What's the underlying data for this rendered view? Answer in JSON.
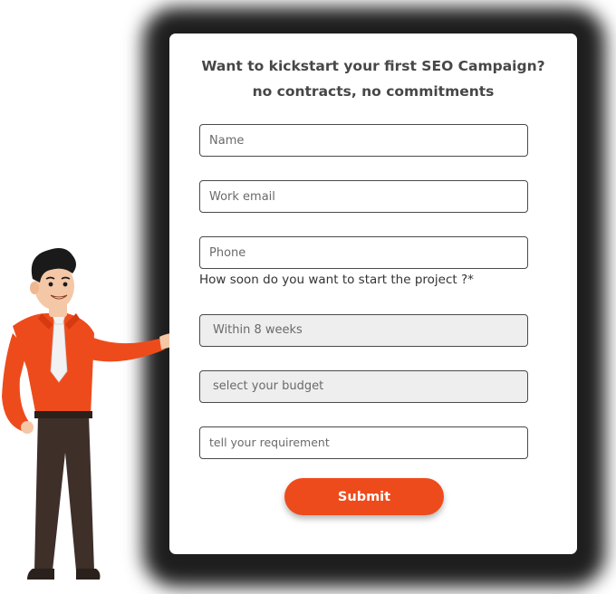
{
  "form": {
    "headline_line1": "Want to kickstart your first SEO Campaign?",
    "headline_line2": "no contracts, no commitments",
    "name_placeholder": "Name",
    "email_placeholder": "Work email",
    "phone_placeholder": "Phone",
    "timeline_question": "How soon do you want to start the project ?*",
    "timeline_selected": "Within 8 weeks",
    "budget_selected": "select your budget",
    "requirement_placeholder": "tell your requirement",
    "submit_label": "Submit"
  },
  "colors": {
    "accent": "#ee4b1c",
    "shirt": "#ee4b1c",
    "pants": "#3e2f29",
    "card_shadow": "#1e1e1e"
  },
  "illustration": {
    "icon": "businessman-presenting-illustration"
  }
}
